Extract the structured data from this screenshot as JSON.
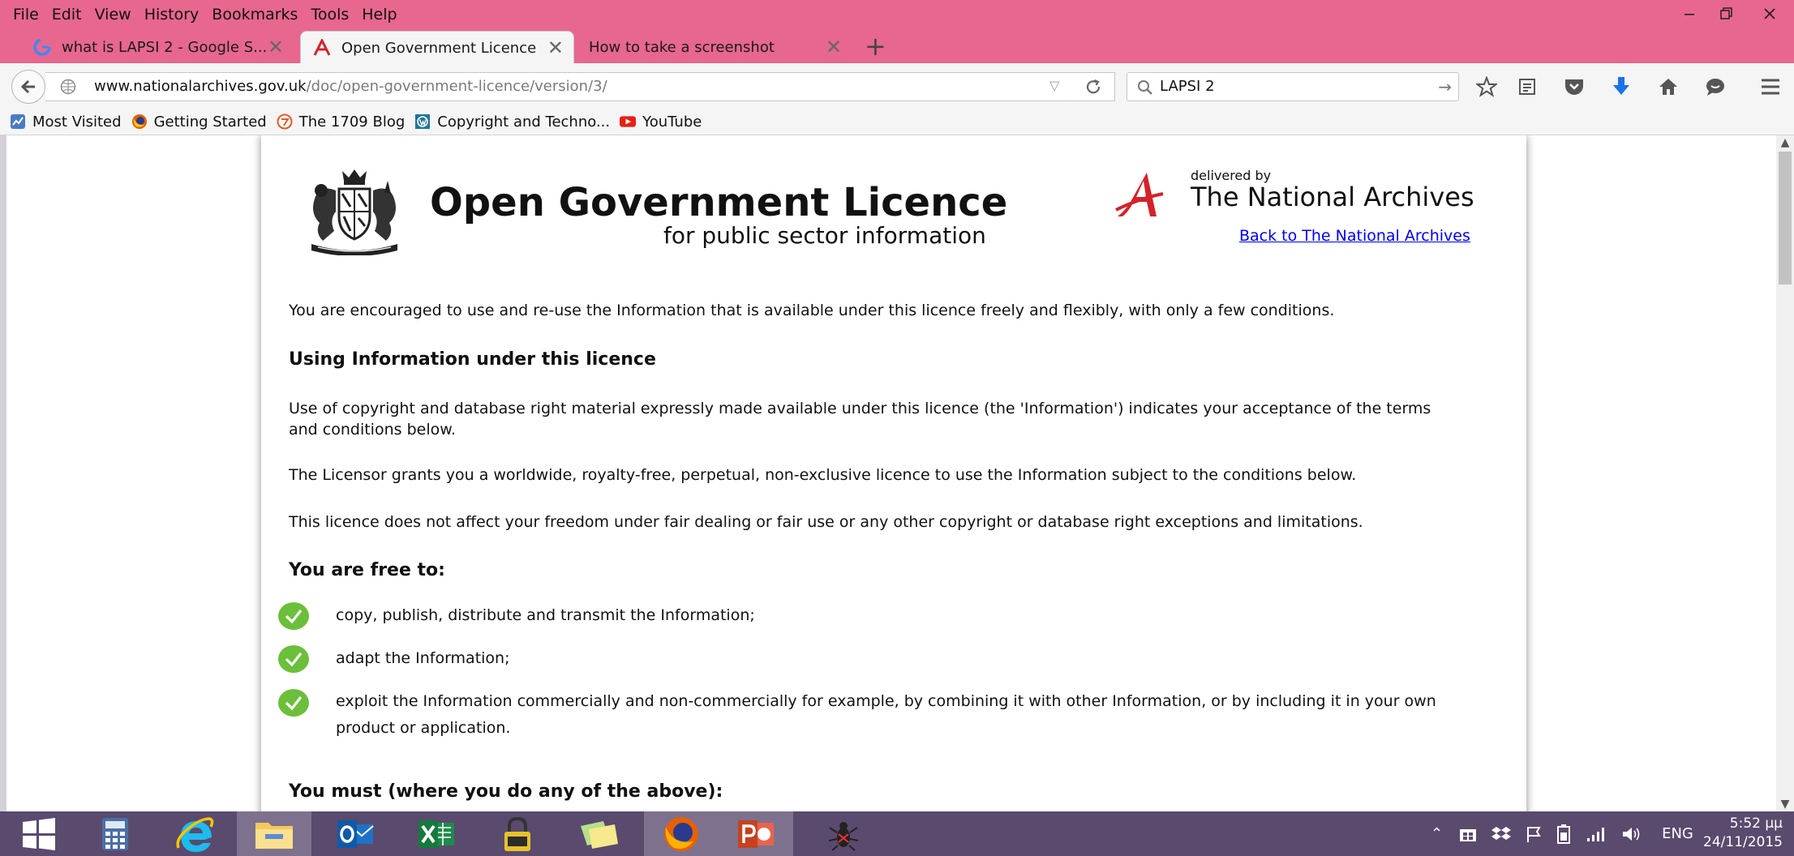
{
  "window": {
    "menu": [
      "File",
      "Edit",
      "View",
      "History",
      "Bookmarks",
      "Tools",
      "Help"
    ]
  },
  "tabs": [
    {
      "label": "what is LAPSI 2 - Google S...",
      "favicon": "google-icon",
      "active": false
    },
    {
      "label": "Open Government Licence",
      "favicon": "national-archives-icon",
      "active": true
    },
    {
      "label": "How to take a screenshot",
      "favicon": "",
      "active": false
    }
  ],
  "toolbar": {
    "url_host": "www.nationalarchives.gov.uk",
    "url_path": "/doc/open-government-licence/version/3/",
    "search_value": "LAPSI 2"
  },
  "bookmarks": [
    {
      "label": "Most Visited",
      "icon": "most-visited-icon"
    },
    {
      "label": "Getting Started",
      "icon": "firefox-icon"
    },
    {
      "label": "The 1709 Blog",
      "icon": "blog-icon"
    },
    {
      "label": "Copyright and Techno...",
      "icon": "wordpress-icon"
    },
    {
      "label": "YouTube",
      "icon": "youtube-icon"
    }
  ],
  "page": {
    "title": "Open Government Licence",
    "subtitle": "for public sector information",
    "delivered_by": "delivered by",
    "tna_name": "The National Archives",
    "back_link": "Back to The National Archives",
    "intro": "You are encouraged to use and re-use the Information that is available under this licence freely and flexibly, with only a few conditions.",
    "heading_using": "Using Information under this licence",
    "para_use": "Use of copyright and database right material expressly made available under this licence (the 'Information') indicates your acceptance of the terms and conditions below.",
    "para_grant": "The Licensor grants you a worldwide, royalty-free, perpetual, non-exclusive licence to use the Information subject to the conditions below.",
    "para_affect": "This licence does not affect your freedom under fair dealing or fair use or any other copyright or database right exceptions and limitations.",
    "heading_free": "You are free to:",
    "free_items": [
      "copy, publish, distribute and transmit the Information;",
      "adapt the Information;",
      "exploit the Information commercially and non-commercially for example, by combining it with other Information, or by including it in your own product or application."
    ],
    "heading_must": "You must (where you do any of the above):"
  },
  "taskbar": {
    "apps": [
      "start",
      "calculator",
      "internet-explorer",
      "file-explorer",
      "outlook",
      "excel",
      "keepass",
      "sticky-notes",
      "firefox",
      "powerpoint",
      "snipping-bug"
    ],
    "lang": "ENG",
    "time": "5:52 μμ",
    "date": "24/11/2015"
  },
  "colors": {
    "chrome_pink": "#e8678f",
    "check_green": "#6cbf3a",
    "link_blue": "#0000ee",
    "tna_red": "#d2232a",
    "taskbar": "#5a4a6e"
  }
}
